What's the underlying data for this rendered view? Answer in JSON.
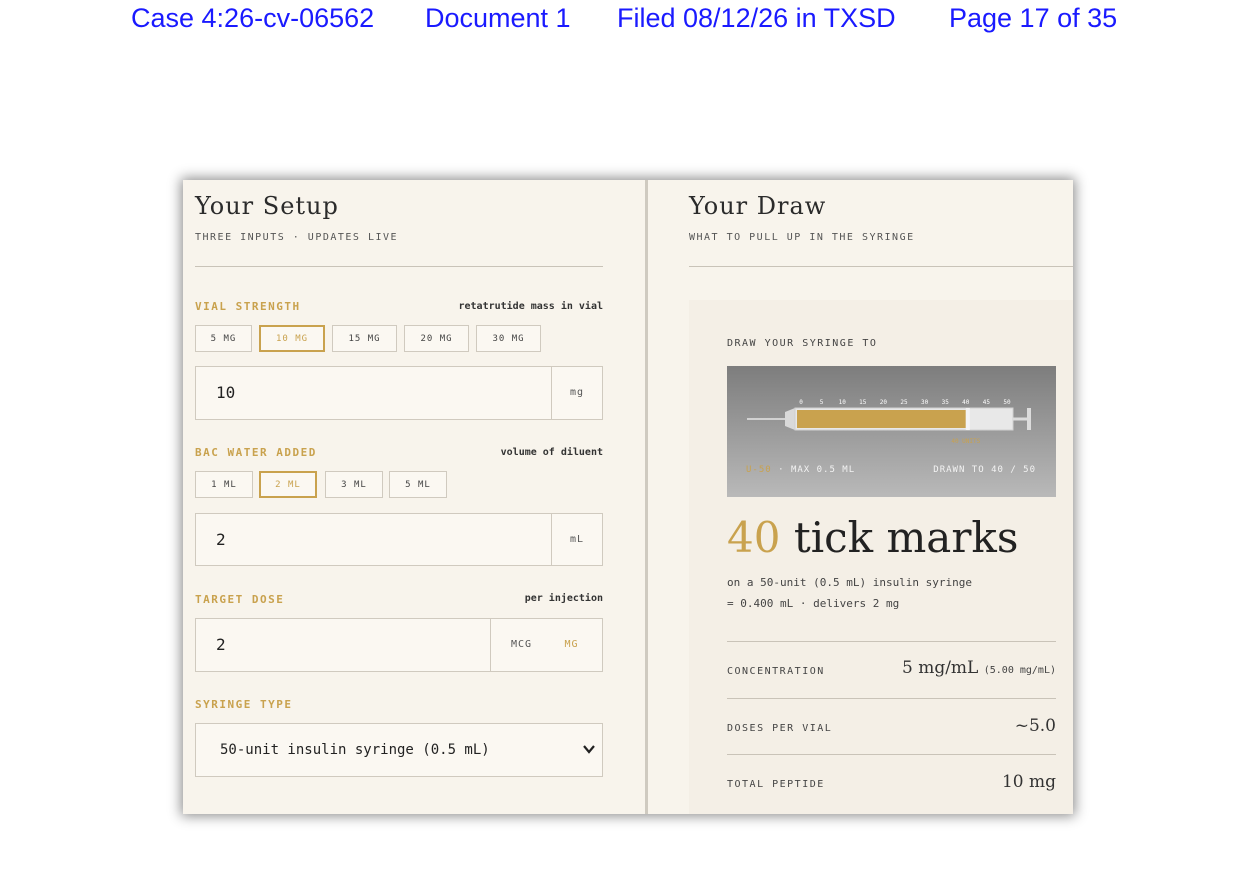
{
  "doc_header": {
    "case": "Case 4:26-cv-06562",
    "document": "Document 1",
    "filed": "Filed 08/12/26 in TXSD",
    "page": "Page 17 of 35"
  },
  "colors": {
    "accent": "#c9a24e",
    "header_link": "#1a1aff",
    "panel_bg": "#f8f4ec"
  },
  "setup": {
    "title": "Your Setup",
    "subtitle": "THREE INPUTS · UPDATES LIVE",
    "vial": {
      "label": "VIAL STRENGTH",
      "hint": "retatrutide mass in vial",
      "chips": [
        "5 MG",
        "10 MG",
        "15 MG",
        "20 MG",
        "30 MG"
      ],
      "selected_chip": "10 MG",
      "value": "10",
      "unit": "mg"
    },
    "water": {
      "label": "BAC WATER ADDED",
      "hint": "volume of diluent",
      "chips": [
        "1 ML",
        "2 ML",
        "3 ML",
        "5 ML"
      ],
      "selected_chip": "2 ML",
      "value": "2",
      "unit": "mL"
    },
    "dose": {
      "label": "TARGET DOSE",
      "hint": "per injection",
      "value": "2",
      "unit_mcg": "MCG",
      "unit_mg": "MG",
      "active_unit": "MG"
    },
    "syringe": {
      "label": "SYRINGE TYPE",
      "selected": "50-unit insulin syringe (0.5 mL)"
    }
  },
  "draw": {
    "title": "Your Draw",
    "subtitle": "WHAT TO PULL UP IN THE SYRINGE",
    "draw_to_label": "DRAW YOUR SYRINGE TO",
    "syringe_graphic": {
      "ticks": [
        "0",
        "5",
        "10",
        "15",
        "20",
        "25",
        "30",
        "35",
        "40",
        "45",
        "50"
      ],
      "max_units": 50,
      "drawn_units": 40,
      "badge": "40 UNITS",
      "caption_left_type": "U-50",
      "caption_left_rest": "· MAX 0.5 ML",
      "caption_right": "DRAWN TO 40 / 50"
    },
    "big_number": "40",
    "big_text": "tick marks",
    "line1": "on a 50-unit (0.5 mL) insulin syringe",
    "line2": "= 0.400 mL · delivers 2 mg",
    "stats": [
      {
        "label": "CONCENTRATION",
        "value": "5 mg/mL",
        "aux": "(5.00 mg/mL)"
      },
      {
        "label": "DOSES PER VIAL",
        "value": "~5.0",
        "aux": ""
      },
      {
        "label": "TOTAL PEPTIDE",
        "value": "10 mg",
        "aux": ""
      }
    ]
  }
}
